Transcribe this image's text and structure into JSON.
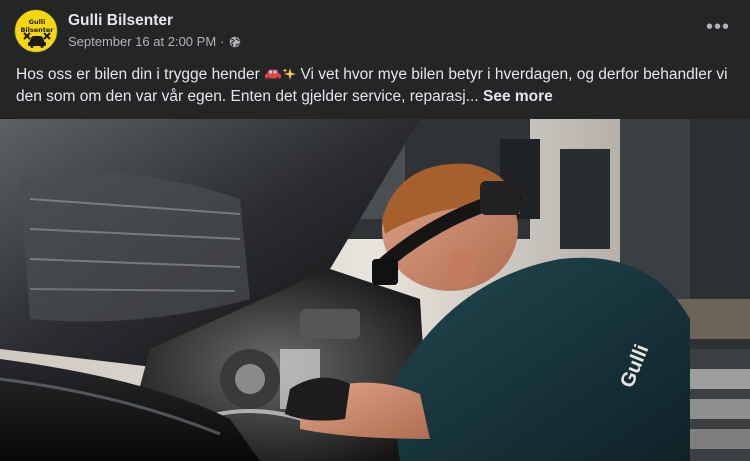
{
  "post": {
    "page_name": "Gulli Bilsenter",
    "avatar_text": "Gulli Bilsenter",
    "date": "September 16 at 2:00 PM",
    "separator": "·",
    "audience_icon": "globe-icon",
    "more_icon": "ellipsis-icon",
    "more_label": "•••",
    "caption_part1": "Hos oss er bilen din i trygge hender ",
    "caption_emojis": [
      "car-emoji",
      "sparkles-emoji"
    ],
    "caption_part2": " Vi vet hvor mye bilen betyr i hverdagen, og derfor behandler vi den som om den var vår egen. Enten det gjelder service, reparasj...",
    "see_more": "See more",
    "photo_shirt_text": "Gulli"
  },
  "colors": {
    "background": "#242526",
    "primary_text": "#e4e6eb",
    "secondary_text": "#b0b3b8",
    "avatar_yellow": "#f5d60f"
  }
}
